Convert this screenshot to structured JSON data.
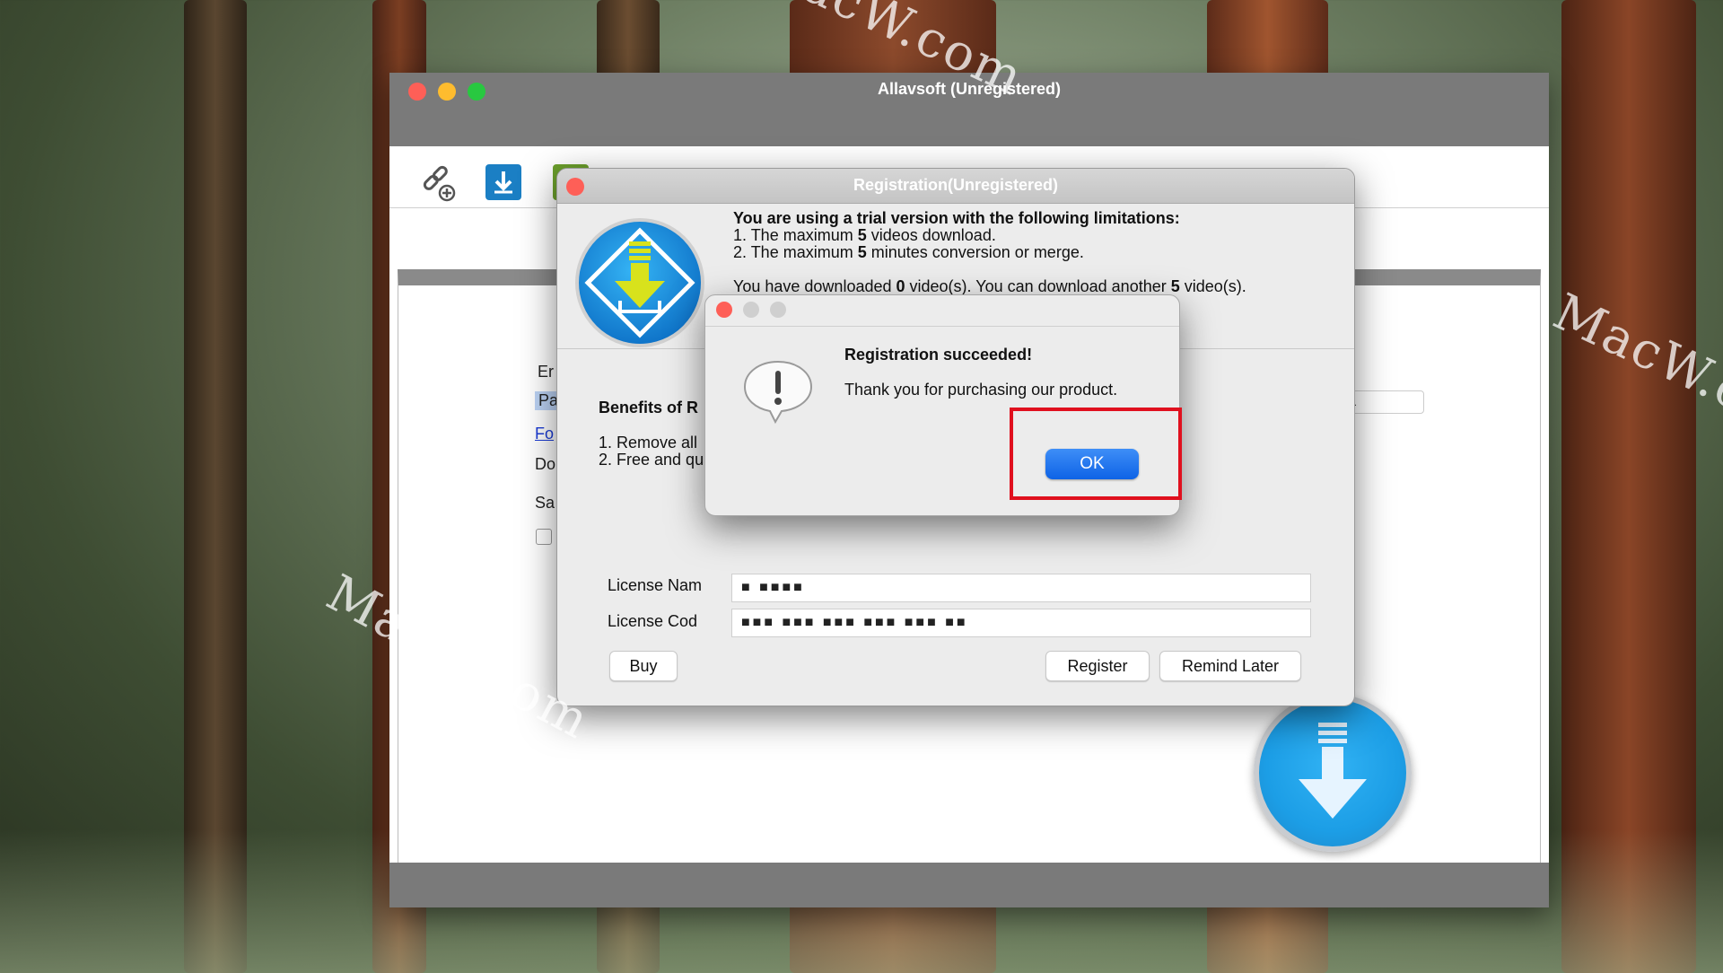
{
  "desktop": {
    "watermark_text": "MacW.com"
  },
  "app": {
    "title": "Allavsoft (Unregistered)",
    "bg_fragments": {
      "enter": "Er",
      "paste": "Pa",
      "for": "Fo",
      "do": "Do",
      "sa": "Sa",
      "url": "RL"
    },
    "toolbar_icons": [
      "link-add-icon",
      "download-icon"
    ]
  },
  "registration": {
    "title": "Registration(Unregistered)",
    "limits_heading": "You are using a trial version with the following limitations:",
    "limit_1_prefix": "1. The maximum ",
    "limit_1_num": "5",
    "limit_1_suffix": " videos download.",
    "limit_2_prefix": "2. The maximum ",
    "limit_2_num": "5",
    "limit_2_suffix": " minutes conversion or merge.",
    "status_prefix": "You have downloaded ",
    "status_downloaded": "0",
    "status_middle": " video(s). You can download another ",
    "status_remaining": "5",
    "status_suffix": " video(s).",
    "benefits_heading": "Benefits of R",
    "benefit_1": "1. Remove all",
    "benefit_2": "2. Free and qu",
    "license_name_label": "License Nam",
    "license_code_label": "License Cod",
    "license_name_value": "■ ■■■■",
    "license_code_value": "■■■ ■■■ ■■■ ■■■ ■■■ ■■",
    "buy_label": "Buy",
    "register_label": "Register",
    "remind_label": "Remind Later"
  },
  "alert": {
    "title": "Registration succeeded!",
    "message": "Thank you for purchasing our product.",
    "ok_label": "OK",
    "icon": "exclamation-speech-icon"
  },
  "colors": {
    "traffic_red": "#fe5f57",
    "traffic_yellow": "#febc2e",
    "traffic_green": "#28c840",
    "accent_blue": "#0e63e6",
    "highlight_red": "#e0101e"
  }
}
